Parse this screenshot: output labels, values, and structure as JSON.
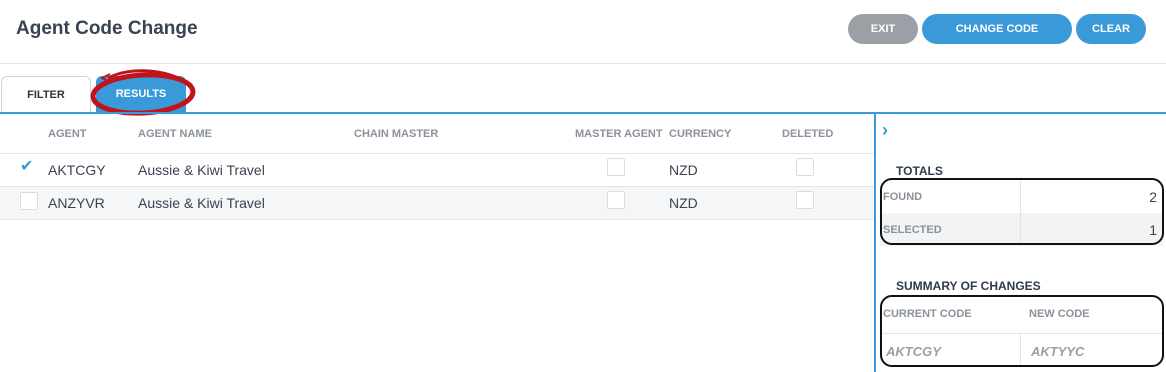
{
  "page": {
    "title": "Agent Code Change"
  },
  "toolbar": {
    "exit_label": "EXIT",
    "change_code_label": "CHANGE CODE",
    "clear_label": "CLEAR"
  },
  "tabs": [
    {
      "label": "FILTER",
      "active": false
    },
    {
      "label": "RESULTS",
      "active": true
    }
  ],
  "table": {
    "columns": [
      "AGENT",
      "AGENT NAME",
      "CHAIN MASTER",
      "MASTER AGENT",
      "CURRENCY",
      "DELETED"
    ],
    "rows": [
      {
        "selected": true,
        "agent": "AKTCGY",
        "agent_name": "Aussie & Kiwi Travel",
        "chain_master": "",
        "master_agent": false,
        "currency": "NZD",
        "deleted": false
      },
      {
        "selected": false,
        "agent": "ANZYVR",
        "agent_name": "Aussie & Kiwi Travel",
        "chain_master": "",
        "master_agent": false,
        "currency": "NZD",
        "deleted": false
      }
    ]
  },
  "totals": {
    "title": "TOTALS",
    "found_label": "FOUND",
    "found_value": "2",
    "selected_label": "SELECTED",
    "selected_value": "1"
  },
  "summary": {
    "title": "SUMMARY OF CHANGES",
    "current_code_label": "CURRENT CODE",
    "new_code_label": "NEW CODE",
    "current_code_value": "AKTCGY",
    "new_code_value": "AKTYYC"
  },
  "icons": {
    "expand_panel": "chevron-right-icon",
    "checkbox_checked": "checkmark-icon"
  },
  "colors": {
    "accent": "#3a9ad9",
    "exit_button": "#9aa0a6",
    "annotation": "#c0141c"
  }
}
